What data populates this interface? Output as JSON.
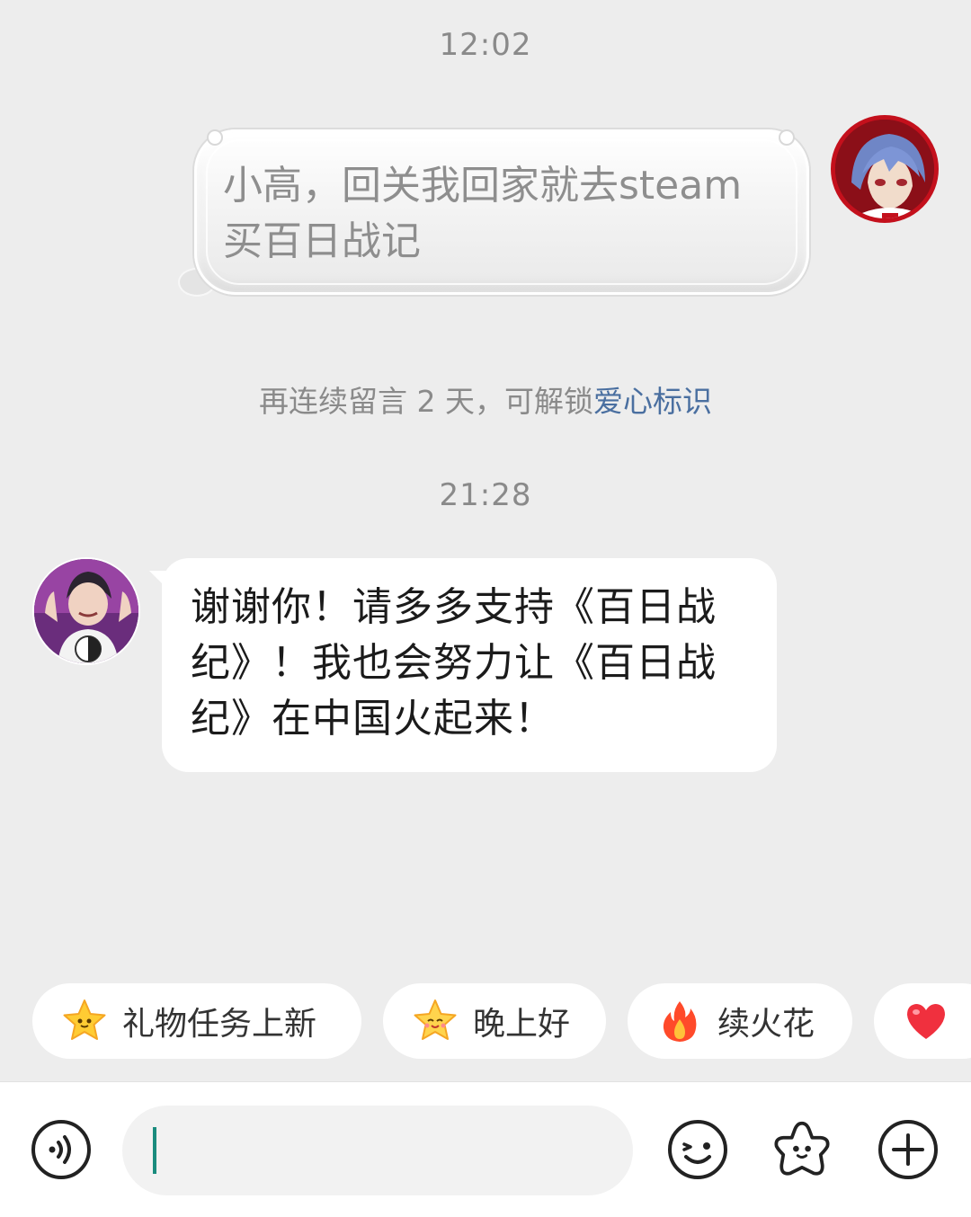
{
  "chat": {
    "timestamp_1": "12:02",
    "outgoing_message": "小高，回关我回家就去steam买百日战记",
    "system_note": {
      "prefix": "再连续留言 2 天，可解锁",
      "link": "爱心标识"
    },
    "timestamp_2": "21:28",
    "incoming_message": "谢谢你！请多多支持《百日战纪》！我也会努力让《百日战纪》在中国火起来！"
  },
  "quick_replies": [
    {
      "icon": "star-smile-icon",
      "label": "礼物任务上新"
    },
    {
      "icon": "star-wink-icon",
      "label": "晚上好"
    },
    {
      "icon": "fire-icon",
      "label": "续火花"
    },
    {
      "icon": "heart-icon",
      "label": ""
    }
  ],
  "input_bar": {
    "value": "",
    "placeholder": "",
    "icons": [
      "voice-icon",
      "emoji-icon",
      "sticker-icon",
      "plus-icon"
    ]
  },
  "colors": {
    "background": "#ededed",
    "link": "#4a6fa0",
    "caret": "#1a8c7e",
    "bubble_incoming": "#ffffff"
  }
}
